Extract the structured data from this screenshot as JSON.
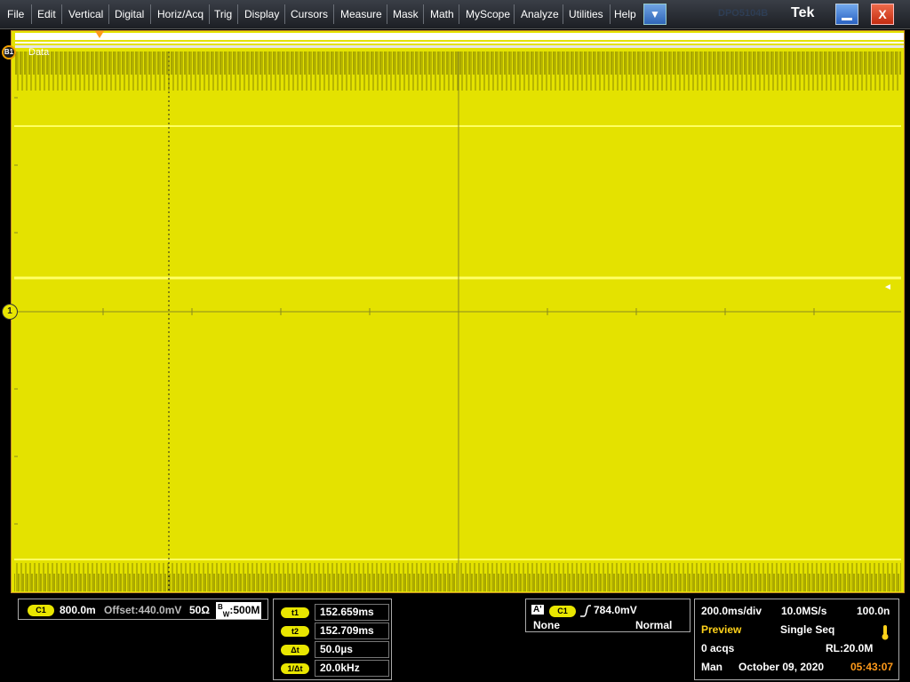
{
  "menu": {
    "items": [
      "File",
      "Edit",
      "Vertical",
      "Digital",
      "Horiz/Acq",
      "Trig",
      "Display",
      "Cursors",
      "Measure",
      "Mask",
      "Math",
      "MyScope",
      "Analyze",
      "Utilities",
      "Help"
    ],
    "dropdown_glyph": "▼",
    "brand": "Tek",
    "ghost_text": "DPO5104B",
    "minimize_icon": "minimize-icon",
    "close_glyph": "X"
  },
  "waveform": {
    "bus_label": "B1",
    "bus_badge": "B1",
    "bus_signal": "Data",
    "channel_marker": "1",
    "trigger_level_marker": "◄",
    "trace_color": "#e4e200",
    "grid_color": "#8a8a20"
  },
  "channel": {
    "badge": "C1",
    "scale": "800.0m",
    "offset": "Offset:440.0mV",
    "impedance": "50Ω",
    "bandwidth_prefix": "B",
    "bandwidth_sub": "W",
    "bandwidth": ":500M"
  },
  "cursors": [
    {
      "label": "t1",
      "value": "152.659ms"
    },
    {
      "label": "t2",
      "value": "152.709ms"
    },
    {
      "label": "Δt",
      "value": "50.0µs"
    },
    {
      "label": "1/Δt",
      "value": "20.0kHz"
    }
  ],
  "trigger": {
    "type_badge": "A'",
    "source": "C1",
    "level": "784.0mV",
    "coupling": "None",
    "mode": "Normal"
  },
  "acquisition": {
    "horizontal_scale": "200.0ms/div",
    "sample_rate": "10.0MS/s",
    "resolution": "100.0n",
    "status": "Preview",
    "run_mode": "Single Seq",
    "acq_count": "0 acqs",
    "record_length": "RL:20.0M",
    "timebase_mode": "Man",
    "date": "October 09, 2020",
    "time": "05:43:07"
  }
}
